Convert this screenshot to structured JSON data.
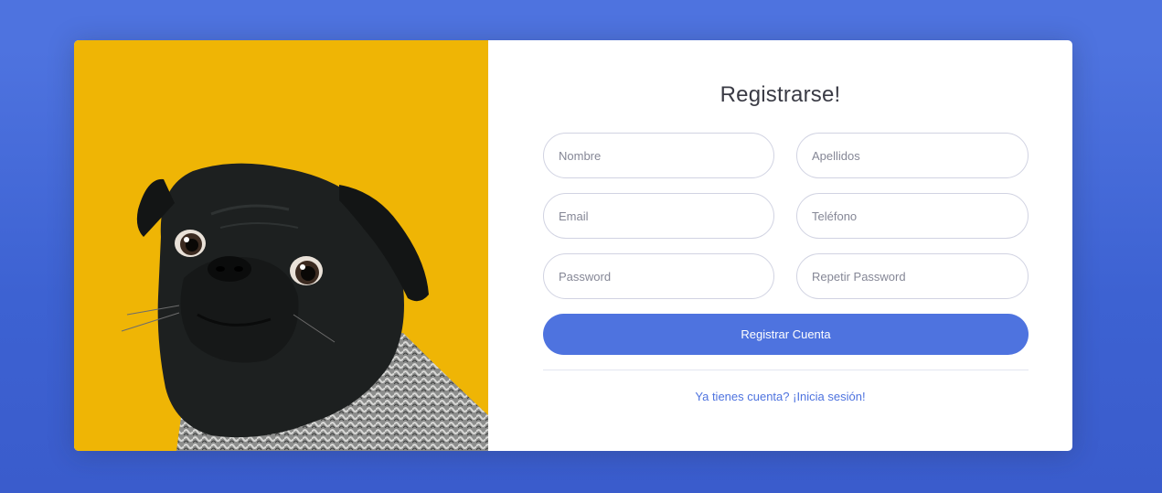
{
  "colors": {
    "page_background": "#4e73df",
    "primary": "#4e73df",
    "photo_background": "#efb505",
    "title_text": "#3a3b45",
    "input_border": "#d1d3e2"
  },
  "photo": {
    "description_icon": "pug-dog-photo"
  },
  "register": {
    "title": "Registrarse!",
    "fields": {
      "first_name_placeholder": "Nombre",
      "last_name_placeholder": "Apellidos",
      "email_placeholder": "Email",
      "phone_placeholder": "Teléfono",
      "password_placeholder": "Password",
      "repeat_password_placeholder": "Repetir Password"
    },
    "submit_label": "Registrar Cuenta",
    "login_link_text": "Ya tienes cuenta? ¡Inicia sesión!"
  }
}
